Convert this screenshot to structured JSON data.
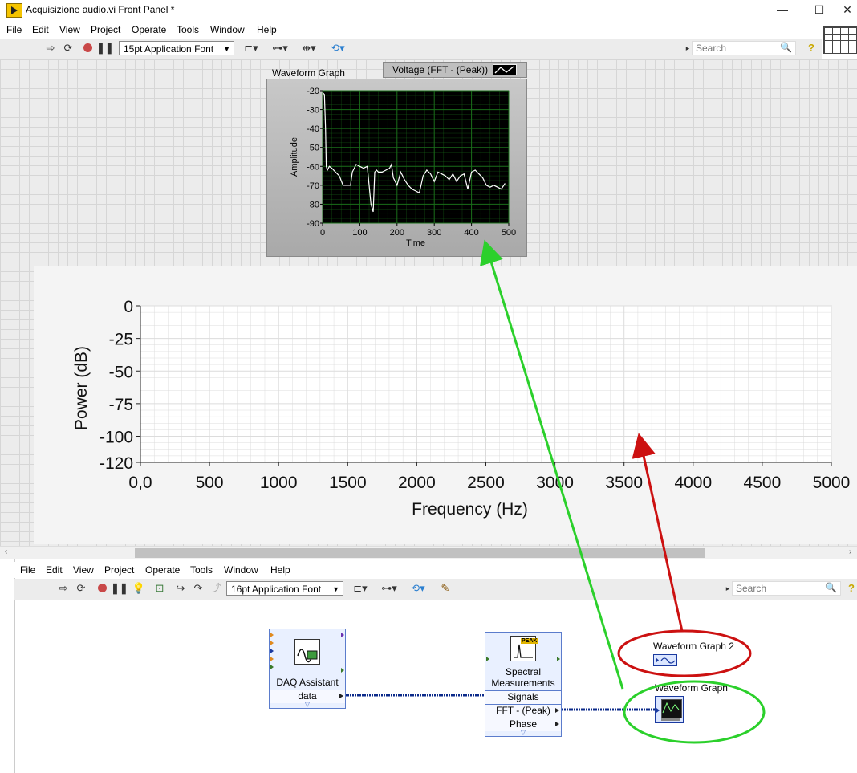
{
  "window": {
    "title": "Acquisizione audio.vi Front Panel *",
    "controls": [
      "—",
      "☐",
      "✕"
    ]
  },
  "front_panel": {
    "menu": [
      "File",
      "Edit",
      "View",
      "Project",
      "Operate",
      "Tools",
      "Window",
      "Help"
    ],
    "font": "15pt Application Font",
    "search_placeholder": "Search"
  },
  "waveform_graph": {
    "label": "Waveform Graph",
    "legend": "Voltage (FFT - (Peak))",
    "colors": {
      "plot": "#000000",
      "grid": "#1a6e1a",
      "trace": "#ffffff"
    }
  },
  "waveform_graph_2": {
    "colors": {
      "background": "#ffffff",
      "grid": "#dcdcdc"
    }
  },
  "chart_data": [
    {
      "type": "line",
      "xlabel": "Time",
      "ylabel": "Amplitude",
      "xlim": [
        0,
        500
      ],
      "ylim": [
        -90,
        -20
      ],
      "xticks": [
        "0",
        "100",
        "200",
        "300",
        "400",
        "500"
      ],
      "yticks": [
        "-20",
        "-30",
        "-40",
        "-50",
        "-60",
        "-70",
        "-80",
        "-90"
      ],
      "grid": true,
      "series": [
        {
          "x": [
            0,
            5,
            8,
            10,
            13,
            18,
            25,
            35,
            45,
            55,
            65,
            75,
            80,
            90,
            100,
            110,
            120,
            130,
            136,
            140,
            145,
            150,
            160,
            170,
            180,
            185,
            190,
            200,
            210,
            220,
            230,
            240,
            250,
            260,
            270,
            280,
            290,
            300,
            310,
            320,
            330,
            340,
            350,
            360,
            370,
            380,
            390,
            400,
            410,
            420,
            430,
            440,
            450,
            460,
            470,
            480,
            490
          ],
          "y": [
            -21,
            -22,
            -40,
            -60,
            -62,
            -60,
            -61,
            -63,
            -65,
            -70,
            -70,
            -70,
            -63,
            -59,
            -60,
            -61,
            -60,
            -80,
            -84,
            -63,
            -62,
            -63,
            -63,
            -62,
            -61,
            -59,
            -66,
            -70,
            -63,
            -67,
            -70,
            -72,
            -73,
            -74,
            -65,
            -62,
            -64,
            -68,
            -63,
            -64,
            -65,
            -67,
            -64,
            -68,
            -65,
            -64,
            -72,
            -63,
            -62,
            -64,
            -66,
            -70,
            -71,
            -70,
            -71,
            -72,
            -69
          ]
        }
      ]
    },
    {
      "type": "line",
      "xlabel": "Frequency (Hz)",
      "ylabel": "Power (dB)",
      "xlim": [
        0,
        5000
      ],
      "ylim": [
        -120,
        0
      ],
      "xticks": [
        "0,0",
        "500",
        "1000",
        "1500",
        "2000",
        "2500",
        "3000",
        "3500",
        "4000",
        "4500",
        "5000"
      ],
      "yticks": [
        "0",
        "-25",
        "-50",
        "-75",
        "-100",
        "-120"
      ],
      "grid": true,
      "series": []
    }
  ],
  "block_diagram": {
    "menu": [
      "File",
      "Edit",
      "View",
      "Project",
      "Operate",
      "Tools",
      "Window",
      "Help"
    ],
    "font": "16pt Application Font",
    "search_placeholder": "Search",
    "daq": {
      "title": "DAQ Assistant",
      "terminal": "data"
    },
    "spectral": {
      "title": [
        "Spectral",
        "Measurements"
      ],
      "terminals": [
        "Signals",
        "FFT - (Peak)",
        "Phase"
      ]
    },
    "terminals": {
      "graph2": "Waveform Graph 2",
      "graph": "Waveform Graph"
    },
    "annotation_colors": {
      "red": "#cc1111",
      "green": "#2bd02b"
    }
  }
}
